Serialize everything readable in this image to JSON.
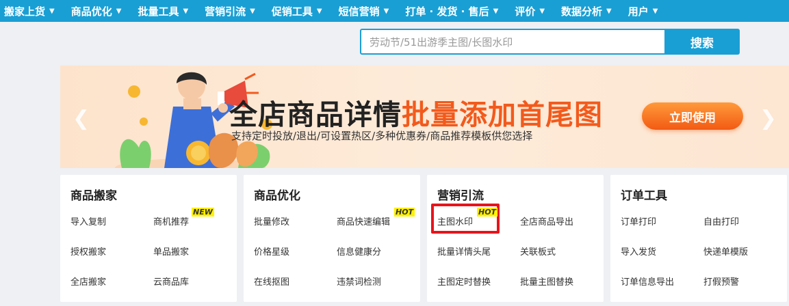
{
  "nav": [
    {
      "label": "搬家上货"
    },
    {
      "label": "商品优化"
    },
    {
      "label": "批量工具"
    },
    {
      "label": "营销引流"
    },
    {
      "label": "促销工具"
    },
    {
      "label": "短信营销"
    },
    {
      "label": "打单 · 发货 · 售后"
    },
    {
      "label": "评价"
    },
    {
      "label": "数据分析"
    },
    {
      "label": "用户"
    }
  ],
  "search": {
    "placeholder": "劳动节/51出游季主图/长图水印",
    "button": "搜索"
  },
  "banner": {
    "title_main": "全店商品详情",
    "title_highlight": "批量添加首尾图",
    "subtitle": "支持定时投放/退出/可设置热区/多种优惠券/商品推荐模板供您选择",
    "cta": "立即使用"
  },
  "cards": [
    {
      "title": "商品搬家",
      "links": [
        {
          "label": "导入复制"
        },
        {
          "label": "商机推荐",
          "badge": "NEW"
        },
        {
          "label": "授权搬家"
        },
        {
          "label": "单品搬家"
        },
        {
          "label": "全店搬家"
        },
        {
          "label": "云商品库"
        }
      ]
    },
    {
      "title": "商品优化",
      "links": [
        {
          "label": "批量修改"
        },
        {
          "label": "商品快速编辑",
          "badge": "HOT"
        },
        {
          "label": "价格星级"
        },
        {
          "label": "信息健康分"
        },
        {
          "label": "在线抠图"
        },
        {
          "label": "违禁词检测"
        }
      ]
    },
    {
      "title": "营销引流",
      "links": [
        {
          "label": "主图水印",
          "badge": "HOT"
        },
        {
          "label": "全店商品导出"
        },
        {
          "label": "批量详情头尾"
        },
        {
          "label": "关联板式"
        },
        {
          "label": "主图定时替换"
        },
        {
          "label": "批量主图替换"
        }
      ]
    },
    {
      "title": "订单工具",
      "links": [
        {
          "label": "订单打印"
        },
        {
          "label": "自由打印"
        },
        {
          "label": "导入发货"
        },
        {
          "label": "快递单模版"
        },
        {
          "label": "订单信息导出"
        },
        {
          "label": "打假预警"
        }
      ]
    }
  ]
}
